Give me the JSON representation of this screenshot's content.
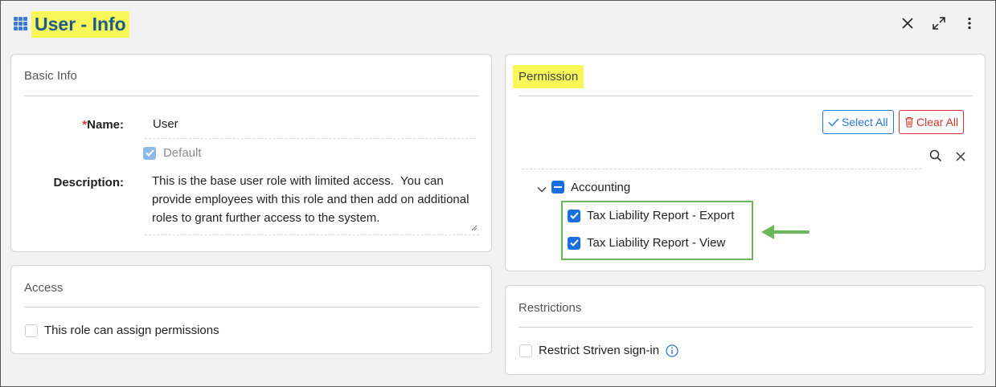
{
  "header": {
    "title": "User - Info",
    "icons": [
      "grid-icon",
      "close-icon",
      "expand-icon",
      "more-vertical-icon"
    ]
  },
  "basic_info": {
    "title": "Basic Info",
    "name_label": "Name:",
    "name_required_mark": "*",
    "name_value": "User",
    "default_label": "Default",
    "default_checked": true,
    "description_label": "Description:",
    "description_value": "This is the base user role with limited access.  You can provide employees with this role and then add on additional roles to grant further access to the system."
  },
  "access": {
    "title": "Access",
    "assign_permissions_label": "This role can assign permissions",
    "assign_permissions_checked": false
  },
  "permission": {
    "title": "Permission",
    "select_all_label": "Select All",
    "clear_all_label": "Clear All",
    "tree": {
      "group_label": "Accounting",
      "group_state": "partial",
      "items": [
        {
          "label": "Tax Liability Report - Export",
          "checked": true
        },
        {
          "label": "Tax Liability Report - View",
          "checked": true
        }
      ]
    }
  },
  "restrictions": {
    "title": "Restrictions",
    "restrict_signin_label": "Restrict Striven sign-in",
    "restrict_signin_checked": false
  },
  "colors": {
    "highlight": "#f7f75a",
    "title_blue": "#1b5a8c",
    "accent_blue": "#1a6fe0",
    "danger_red": "#d0342c",
    "annotation_green": "#6ab85a"
  }
}
